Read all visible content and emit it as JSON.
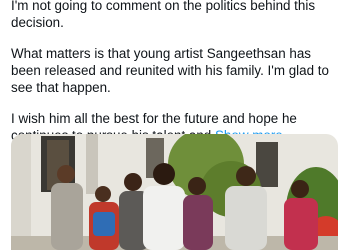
{
  "post": {
    "paragraphs": [
      "I'm not going to comment on the politics behind this decision.",
      "What matters is that young artist Sangeethsan has been released and reunited with his family. I'm glad to see that happen.",
      "I wish him all the best for the future and hope he continues to pursue his talent and"
    ],
    "show_more_label": "Show more"
  },
  "colors": {
    "link": "#1d9bf0",
    "text": "#0f1419",
    "background": "#ffffff"
  },
  "media": {
    "icon": "photo-icon"
  }
}
